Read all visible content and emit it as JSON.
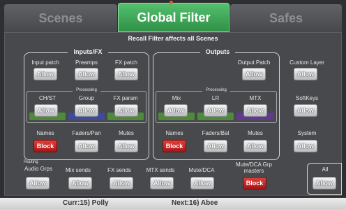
{
  "tabs": {
    "scenes": "Scenes",
    "global_filter": "Global Filter",
    "safes": "Safes"
  },
  "panel_title": "Recall Filter affects all Scenes",
  "inputs_fx": {
    "title": "Inputs/FX",
    "top": [
      {
        "label": "Input patch",
        "state": "Allow"
      },
      {
        "label": "Preamps",
        "state": "Allow"
      },
      {
        "label": "FX patch",
        "state": "Allow"
      }
    ],
    "processing_label": "Processing",
    "processing": [
      {
        "label": "CH/ST",
        "state": "Allow"
      },
      {
        "label": "Group",
        "state": "Allow"
      },
      {
        "label": "FX param",
        "state": "Allow"
      }
    ],
    "bottom": [
      {
        "label": "Names",
        "state": "Block"
      },
      {
        "label": "Faders/Pan",
        "state": "Allow"
      },
      {
        "label": "Mutes",
        "state": "Allow"
      }
    ]
  },
  "outputs": {
    "title": "Outputs",
    "top": [
      {
        "label": "Output Patch",
        "state": "Allow"
      }
    ],
    "processing_label": "Processing",
    "processing": [
      {
        "label": "Mix",
        "state": "Allow"
      },
      {
        "label": "LR",
        "state": "Allow"
      },
      {
        "label": "MTX",
        "state": "Allow"
      }
    ],
    "bottom": [
      {
        "label": "Names",
        "state": "Block"
      },
      {
        "label": "Faders/Bal",
        "state": "Allow"
      },
      {
        "label": "Mutes",
        "state": "Allow"
      }
    ]
  },
  "side": [
    {
      "label": "Custom Layer",
      "state": "Allow"
    },
    {
      "label": "SoftKeys",
      "state": "Allow"
    },
    {
      "label": "System",
      "state": "Allow"
    }
  ],
  "routing": {
    "title": "Routing",
    "items": [
      {
        "label": "Audio Grps",
        "state": "Allow"
      },
      {
        "label": "Mix sends",
        "state": "Allow"
      },
      {
        "label": "FX sends",
        "state": "Allow"
      },
      {
        "label": "MTX sends",
        "state": "Allow"
      },
      {
        "label": "Mute/DCA",
        "state": "Allow"
      }
    ]
  },
  "mute_dca_masters": {
    "label": "Mute/DCA Grp masters",
    "state": "Block"
  },
  "all": {
    "label": "All",
    "state": "Allow"
  },
  "footer": {
    "current": "Curr:15) Polly",
    "next": "Next:16) Abee"
  },
  "colors": {
    "active_tab": "#3fa95a",
    "block": "#c52220",
    "strip_green": "#4f8a3a",
    "strip_blue": "#3f4a9c",
    "strip_purple": "#5f3a8e"
  }
}
